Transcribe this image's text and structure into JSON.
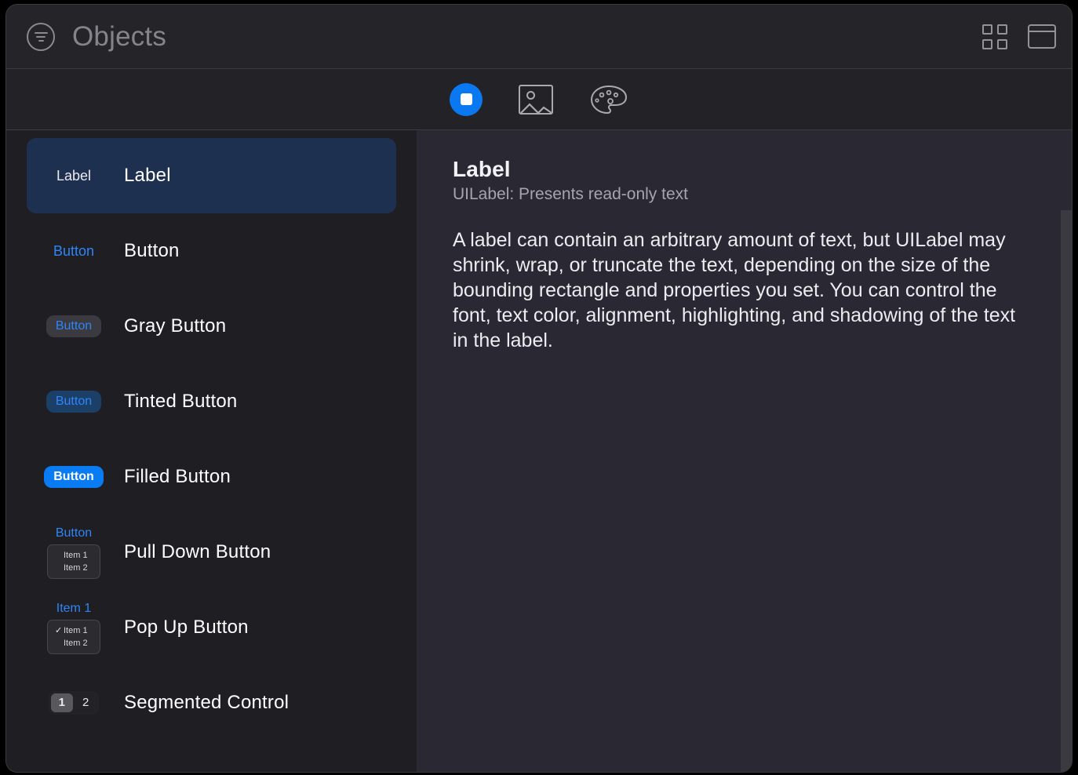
{
  "window": {
    "title": "Objects"
  },
  "titlebar": {
    "filter_icon": "filter-icon",
    "grid_view_icon": "grid-view-icon",
    "panel_view_icon": "panel-view-icon"
  },
  "tabbar": {
    "tabs": [
      {
        "name": "objects",
        "icon": "filled-square-circle-icon",
        "selected": true
      },
      {
        "name": "images",
        "icon": "image-icon",
        "selected": false
      },
      {
        "name": "colors",
        "icon": "palette-icon",
        "selected": false
      }
    ],
    "accent_color": "#0a78f0"
  },
  "list": {
    "items": [
      {
        "label": "Label",
        "preview_type": "plain-label",
        "preview_text": "Label",
        "selected": true
      },
      {
        "label": "Button",
        "preview_type": "plain-button",
        "preview_text": "Button",
        "selected": false
      },
      {
        "label": "Gray Button",
        "preview_type": "pill-gray",
        "preview_text": "Button",
        "selected": false
      },
      {
        "label": "Tinted Button",
        "preview_type": "pill-tinted",
        "preview_text": "Button",
        "selected": false
      },
      {
        "label": "Filled Button",
        "preview_type": "pill-filled",
        "preview_text": "Button",
        "selected": false
      },
      {
        "label": "Pull Down Button",
        "preview_type": "menu",
        "preview_text": "Button",
        "menu_items": [
          "Item 1",
          "Item 2"
        ],
        "checked_index": -1,
        "selected": false
      },
      {
        "label": "Pop Up Button",
        "preview_type": "menu",
        "preview_text": "Item 1",
        "menu_items": [
          "Item 1",
          "Item 2"
        ],
        "checked_index": 0,
        "selected": false
      },
      {
        "label": "Segmented Control",
        "preview_type": "segmented",
        "segments": [
          "1",
          "2"
        ],
        "selected_segment": 0,
        "selected": false
      }
    ]
  },
  "detail": {
    "title": "Label",
    "subtitle": "UILabel: Presents read-only text",
    "body": "A label can contain an arbitrary amount of text, but UILabel may shrink, wrap, or truncate the text, depending on the size of the bounding rectangle and properties you set. You can control the font, text color, alignment, highlighting, and shadowing of the text in the label."
  },
  "colors": {
    "accent": "#0a78f0",
    "selection": "#1e3050",
    "list_background": "#1f1e23",
    "detail_background": "#2a2832",
    "blue_text": "#2f85f7"
  }
}
